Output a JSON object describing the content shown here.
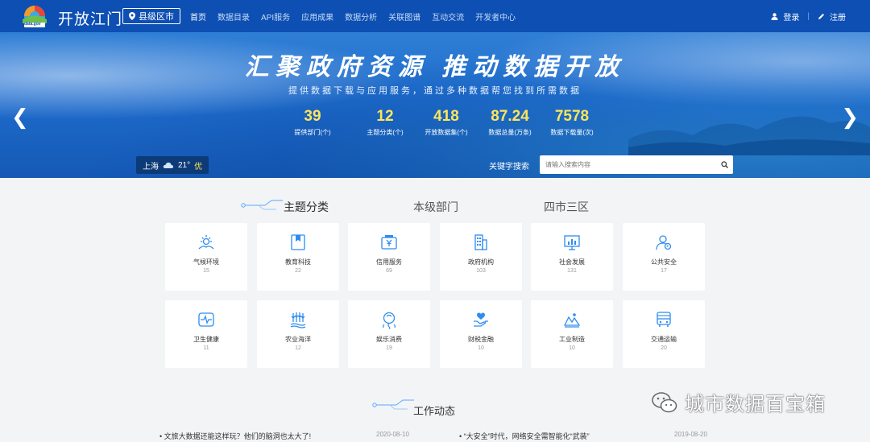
{
  "header": {
    "site_title": "开放江门",
    "logo_caption": "data.gov",
    "region_button": "县级区市",
    "nav": [
      "首页",
      "数据目录",
      "API服务",
      "应用成果",
      "数据分析",
      "关联图谱",
      "互动交流",
      "开发者中心"
    ],
    "login": "登录",
    "register": "注册"
  },
  "banner": {
    "headline": "汇聚政府资源  推动数据开放",
    "subline": "提供数据下载与应用服务，通过多种数据帮您找到所需数据",
    "stats": [
      {
        "value": "39",
        "label": "提供部门(个)"
      },
      {
        "value": "12",
        "label": "主题分类(个)"
      },
      {
        "value": "418",
        "label": "开放数据集(个)"
      },
      {
        "value": "87.24",
        "label": "数据总量(万条)"
      },
      {
        "value": "7578",
        "label": "数据下载量(次)"
      }
    ],
    "weather": {
      "city": "上海",
      "temp": "21°",
      "quality": "优"
    },
    "search": {
      "label": "关键字搜索",
      "placeholder": "请输入搜索内容"
    }
  },
  "tabs": [
    "主题分类",
    "本级部门",
    "四市三区"
  ],
  "categories": [
    {
      "name": "气候环境",
      "count": "15",
      "icon": "sun-icon"
    },
    {
      "name": "教育科技",
      "count": "22",
      "icon": "book-icon"
    },
    {
      "name": "信用服务",
      "count": "69",
      "icon": "yuan-icon"
    },
    {
      "name": "政府机构",
      "count": "103",
      "icon": "building-icon"
    },
    {
      "name": "社会发展",
      "count": "131",
      "icon": "chart-icon"
    },
    {
      "name": "公共安全",
      "count": "17",
      "icon": "user-shield-icon"
    },
    {
      "name": "卫生健康",
      "count": "11",
      "icon": "pulse-icon"
    },
    {
      "name": "农业海洋",
      "count": "12",
      "icon": "plant-icon"
    },
    {
      "name": "娱乐消费",
      "count": "19",
      "icon": "balloon-icon"
    },
    {
      "name": "财税金融",
      "count": "10",
      "icon": "hand-heart-icon"
    },
    {
      "name": "工业制造",
      "count": "10",
      "icon": "factory-icon"
    },
    {
      "name": "交通运输",
      "count": "20",
      "icon": "bus-icon"
    }
  ],
  "news": {
    "title": "工作动态",
    "items": [
      {
        "text": "文旅大数据还能这样玩？他们的脑洞也太大了!",
        "date": "2020-08-10"
      },
      {
        "text": "“大安全”时代，网络安全需智能化“武装”",
        "date": "2019-08-20"
      }
    ]
  },
  "watermark": "城市数据百宝箱",
  "colors": {
    "header": "#0d4fb3",
    "accent": "#1e7fe0",
    "stat_number": "#ffe45c",
    "page_bg": "#f3f4f6"
  }
}
